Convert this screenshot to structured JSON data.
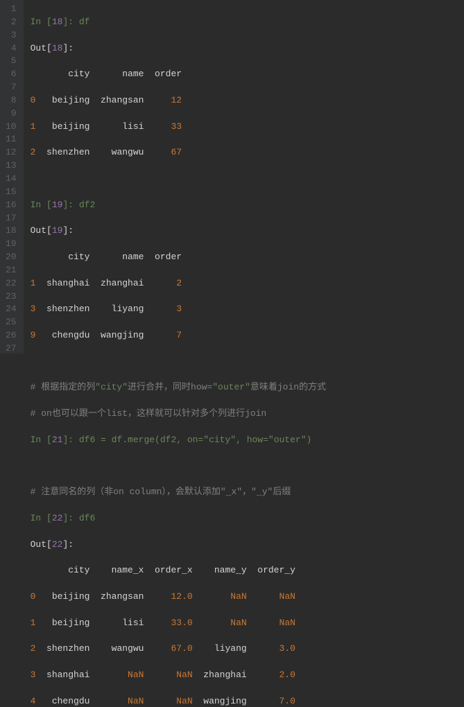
{
  "gutter": [
    "1",
    "2",
    "3",
    "4",
    "5",
    "6",
    "7",
    "8",
    "9",
    "10",
    "11",
    "12",
    "13",
    "14",
    "15",
    "16",
    "17",
    "18",
    "19",
    "20",
    "21",
    "22",
    "23",
    "24",
    "25",
    "26",
    "27"
  ],
  "l1a": "In [",
  "l1b": "18",
  "l1c": "]: df",
  "l2a": "Out[",
  "l2b": "18",
  "l2c": "]:",
  "l3": "       city      name  order",
  "l4a": "0",
  "l4b": "   beijing  zhangsan     ",
  "l4c": "12",
  "l5a": "1",
  "l5b": "   beijing      lisi     ",
  "l5c": "33",
  "l6a": "2",
  "l6b": "  shenzhen    wangwu     ",
  "l6c": "67",
  "l8a": "In [",
  "l8b": "19",
  "l8c": "]: df2",
  "l9a": "Out[",
  "l9b": "19",
  "l9c": "]:",
  "l10": "       city      name  order",
  "l11a": "1",
  "l11b": "  shanghai  zhanghai      ",
  "l11c": "2",
  "l12a": "3",
  "l12b": "  shenzhen    liyang      ",
  "l12c": "3",
  "l13a": "9",
  "l13b": "   chengdu  wangjing      ",
  "l13c": "7",
  "l15a": "# 根据指定的列",
  "l15b": "\"city\"",
  "l15c": "进行合并，同时how=",
  "l15d": "\"outer\"",
  "l15e": "意味着join的方式",
  "l16": "# on也可以跟一个list，这样就可以针对多个列进行join",
  "l17a": "In [",
  "l17b": "21",
  "l17c": "]: df6 = df.merge(df2, on=",
  "l17d": "\"city\"",
  "l17e": ", how=",
  "l17f": "\"outer\"",
  "l17g": ")",
  "l19": "# 注意同名的列（非on column），会默认添加\"_x\"，\"_y\"后缀",
  "l20a": "In [",
  "l20b": "22",
  "l20c": "]: df6",
  "l21a": "Out[",
  "l21b": "22",
  "l21c": "]:",
  "l22": "       city    name_x  order_x    name_y  order_y",
  "l23a": "0",
  "l23b": "   beijing  zhangsan     ",
  "l23c": "12.0",
  "l23d": "       ",
  "l23e": "NaN",
  "l23f": "      ",
  "l23g": "NaN",
  "l24a": "1",
  "l24b": "   beijing      lisi     ",
  "l24c": "33.0",
  "l24d": "       ",
  "l24e": "NaN",
  "l24f": "      ",
  "l24g": "NaN",
  "l25a": "2",
  "l25b": "  shenzhen    wangwu     ",
  "l25c": "67.0",
  "l25d": "    liyang      ",
  "l25e": "3.0",
  "l26a": "3",
  "l26b": "  shanghai       ",
  "l26c": "NaN",
  "l26d": "      ",
  "l26e": "NaN",
  "l26f": "  zhanghai      ",
  "l26g": "2.0",
  "l27a": "4",
  "l27b": "   chengdu       ",
  "l27c": "NaN",
  "l27d": "      ",
  "l27e": "NaN",
  "l27f": "  wangjing      ",
  "l27g": "7.0"
}
